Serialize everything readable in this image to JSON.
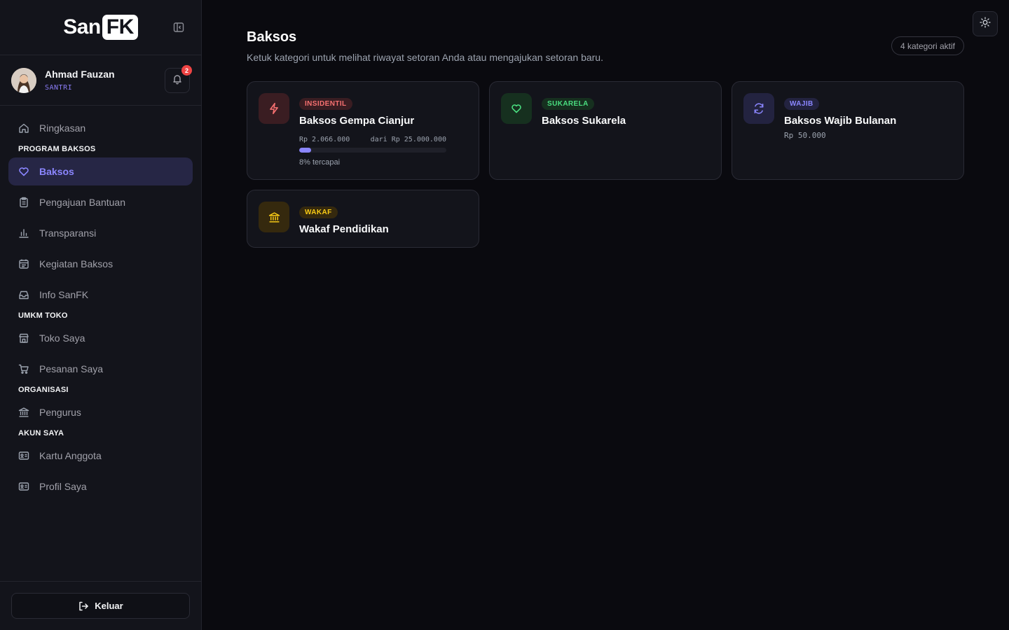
{
  "app": {
    "logo_text": "San",
    "logo_badge": "FK"
  },
  "user": {
    "name": "Ahmad Fauzan",
    "role": "SANTRI",
    "notification_count": "2"
  },
  "sidebar": {
    "items": [
      {
        "label": "Ringkasan",
        "icon": "home-icon"
      },
      {
        "section": "PROGRAM BAKSOS"
      },
      {
        "label": "Baksos",
        "icon": "heart-icon",
        "active": true
      },
      {
        "label": "Pengajuan Bantuan",
        "icon": "clipboard-icon"
      },
      {
        "label": "Transparansi",
        "icon": "bar-chart-icon"
      },
      {
        "label": "Kegiatan Baksos",
        "icon": "calendar-icon"
      },
      {
        "label": "Info SanFK",
        "icon": "inbox-icon"
      },
      {
        "section": "UMKM TOKO"
      },
      {
        "label": "Toko Saya",
        "icon": "store-icon"
      },
      {
        "label": "Pesanan Saya",
        "icon": "cart-icon"
      },
      {
        "section": "ORGANISASI"
      },
      {
        "label": "Pengurus",
        "icon": "landmark-icon"
      },
      {
        "section": "AKUN SAYA"
      },
      {
        "label": "Kartu Anggota",
        "icon": "id-card-icon"
      },
      {
        "label": "Profil Saya",
        "icon": "id-card-icon"
      }
    ],
    "logout_label": "Keluar"
  },
  "main": {
    "title": "Baksos",
    "subtitle": "Ketuk kategori untuk melihat riwayat setoran Anda atau mengajukan setoran baru.",
    "active_count_label": "4 kategori aktif",
    "cards": [
      {
        "badge": "INSIDENTIL",
        "title": "Baksos Gempa Cianjur",
        "collected": "Rp 2.066.000",
        "target": "dari Rp 25.000.000",
        "progress_fraction": 0.08,
        "progress_label": "8% tercapai",
        "icon": "lightning-icon",
        "color": "#f87171"
      },
      {
        "badge": "SUKARELA",
        "title": "Baksos Sukarela",
        "icon": "heart-icon",
        "color": "#4ade80"
      },
      {
        "badge": "WAJIB",
        "title": "Baksos Wajib Bulanan",
        "amount": "Rp 50.000",
        "icon": "refresh-icon",
        "color": "#8b86ff"
      },
      {
        "badge": "WAKAF",
        "title": "Wakaf Pendidikan",
        "icon": "landmark-icon",
        "color": "#facc15"
      }
    ]
  },
  "colors": {
    "accent": "#8b86ff",
    "danger": "#ef4444",
    "background": "#0a0a0f",
    "surface": "#13141b"
  }
}
